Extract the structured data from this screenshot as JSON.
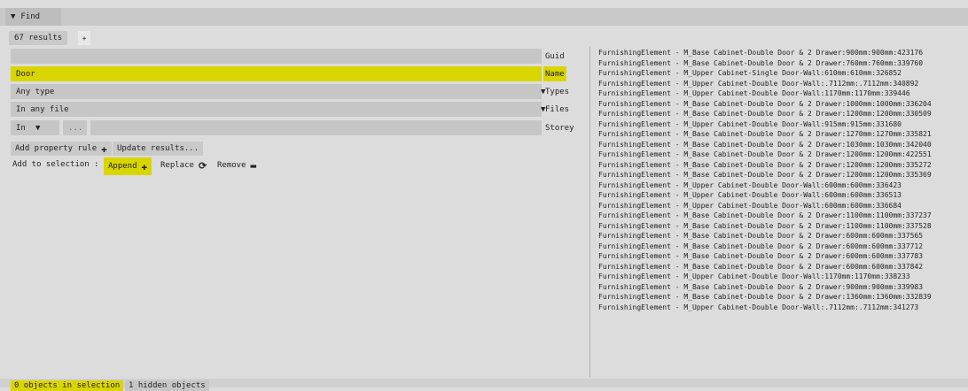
{
  "tab": {
    "label": "Find"
  },
  "results": {
    "count_label": "67 results",
    "add_label": "+"
  },
  "fields": {
    "guid": {
      "value": "",
      "label": "Guid"
    },
    "name": {
      "value": "Door",
      "label": "Name"
    },
    "types": {
      "value": "Any type",
      "label": "Types"
    },
    "files": {
      "value": "In any file",
      "label": "Files"
    },
    "storey": {
      "scope": "In",
      "dots": "...",
      "value": "",
      "label": "Storey"
    }
  },
  "actions": {
    "add_property_rule": "Add property rule",
    "update_results": "Update results...",
    "add_to_selection": "Add to selection :",
    "append": "Append",
    "replace": "Replace",
    "remove": "Remove"
  },
  "results_list": [
    "FurnishingElement - M_Base Cabinet-Double Door & 2 Drawer:900mm:900mm:423176",
    "FurnishingElement - M_Base Cabinet-Double Door & 2 Drawer:760mm:760mm:339760",
    "FurnishingElement - M_Upper Cabinet-Single Door-Wall:610mm:610mm:326852",
    "FurnishingElement - M_Upper Cabinet-Double Door-Wall:.7112mm:.7112mm:340892",
    "FurnishingElement - M_Upper Cabinet-Double Door-Wall:1170mm:1170mm:339446",
    "FurnishingElement - M_Base Cabinet-Double Door & 2 Drawer:1000mm:1000mm:336204",
    "FurnishingElement - M_Base Cabinet-Double Door & 2 Drawer:1200mm:1200mm:330509",
    "FurnishingElement - M_Upper Cabinet-Double Door-Wall:915mm:915mm:331680",
    "FurnishingElement - M_Base Cabinet-Double Door & 2 Drawer:1270mm:1270mm:335821",
    "FurnishingElement - M_Base Cabinet-Double Door & 2 Drawer:1030mm:1030mm:342040",
    "FurnishingElement - M_Base Cabinet-Double Door & 2 Drawer:1200mm:1200mm:422551",
    "FurnishingElement - M_Base Cabinet-Double Door & 2 Drawer:1200mm:1200mm:335272",
    "FurnishingElement - M_Base Cabinet-Double Door & 2 Drawer:1200mm:1200mm:335369",
    "FurnishingElement - M_Upper Cabinet-Double Door-Wall:600mm:600mm:336423",
    "FurnishingElement - M_Upper Cabinet-Double Door-Wall:600mm:600mm:336513",
    "FurnishingElement - M_Upper Cabinet-Double Door-Wall:600mm:600mm:336684",
    "FurnishingElement - M_Base Cabinet-Double Door & 2 Drawer:1100mm:1100mm:337237",
    "FurnishingElement - M_Base Cabinet-Double Door & 2 Drawer:1100mm:1100mm:337528",
    "FurnishingElement - M_Base Cabinet-Double Door & 2 Drawer:600mm:600mm:337565",
    "FurnishingElement - M_Base Cabinet-Double Door & 2 Drawer:600mm:600mm:337712",
    "FurnishingElement - M_Base Cabinet-Double Door & 2 Drawer:600mm:600mm:337783",
    "FurnishingElement - M_Base Cabinet-Double Door & 2 Drawer:600mm:600mm:337842",
    "FurnishingElement - M_Upper Cabinet-Double Door-Wall:1170mm:1170mm:338233",
    "FurnishingElement - M_Base Cabinet-Double Door & 2 Drawer:900mm:900mm:339983",
    "FurnishingElement - M_Base Cabinet-Double Door & 2 Drawer:1360mm:1360mm:332839",
    "FurnishingElement - M_Upper Cabinet-Double Door-Wall:.7112mm:.7112mm:341273"
  ],
  "status": {
    "selection": "0 objects in selection",
    "hidden": "1 hidden objects"
  },
  "colors": {
    "highlight": "#d9d500"
  }
}
